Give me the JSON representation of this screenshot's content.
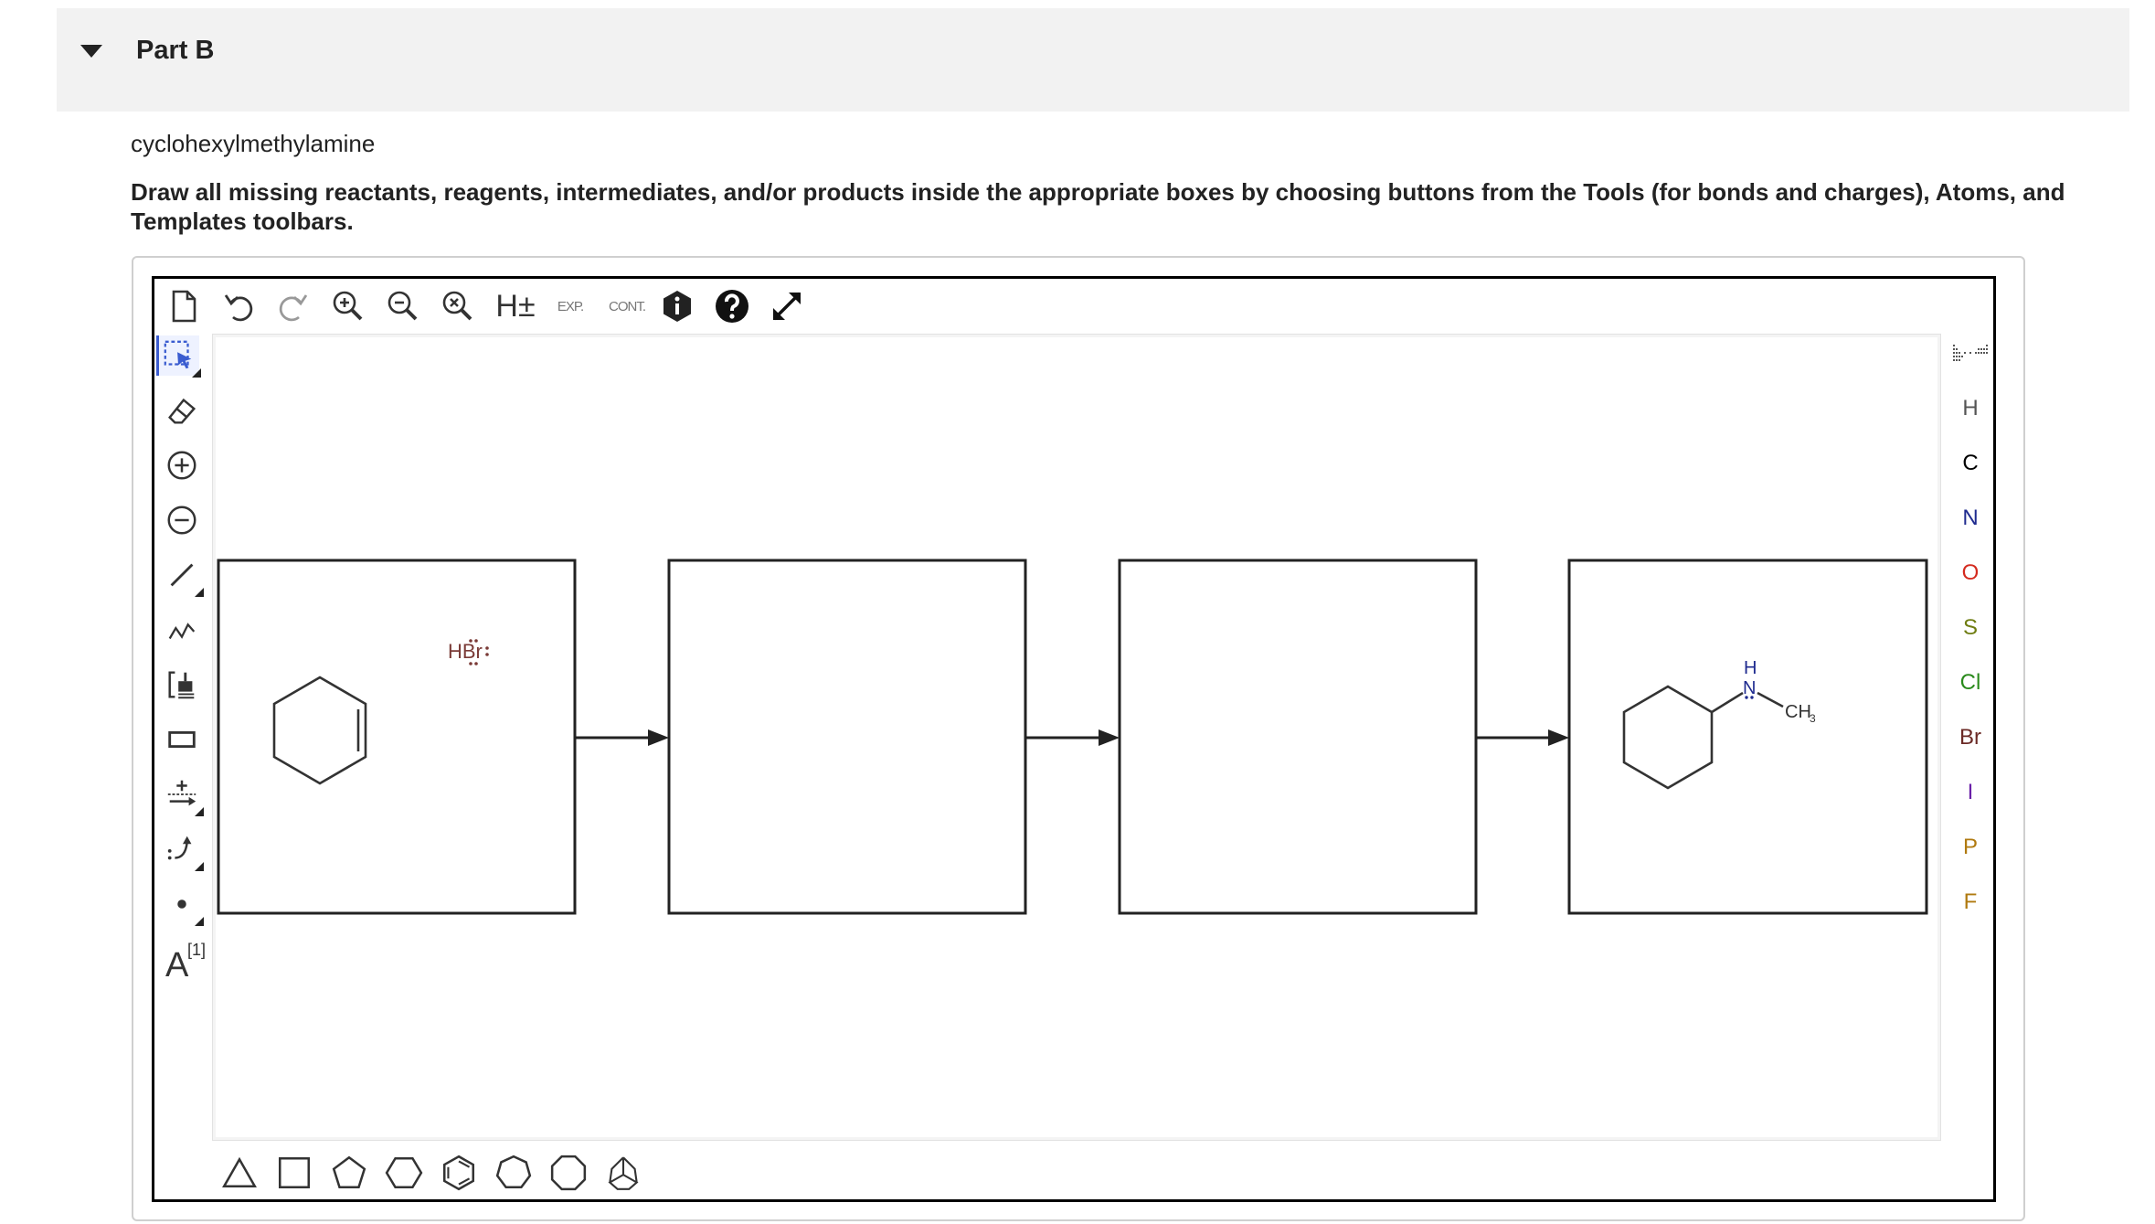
{
  "part": {
    "title": "Part B",
    "subtitle": "cyclohexylmethylamine",
    "instructions": "Draw all missing reactants, reagents, intermediates, and/or products inside the appropriate boxes by choosing buttons from the Tools (for bonds and charges), Atoms, and Templates toolbars."
  },
  "top_toolbar": {
    "implicit_h_label": "H±",
    "expand_label": "EXP.",
    "contract_label": "CONT."
  },
  "left_toolbar": {
    "text_tool_label": "A",
    "text_tool_superscript": "[1]"
  },
  "atoms": [
    {
      "symbol": "H",
      "color": "#555555"
    },
    {
      "symbol": "C",
      "color": "#000000"
    },
    {
      "symbol": "N",
      "color": "#1f2b8f"
    },
    {
      "symbol": "O",
      "color": "#d42a1e"
    },
    {
      "symbol": "S",
      "color": "#6f7d12"
    },
    {
      "symbol": "Cl",
      "color": "#2a8a1c"
    },
    {
      "symbol": "Br",
      "color": "#6b2a26"
    },
    {
      "symbol": "I",
      "color": "#6a1fa8"
    },
    {
      "symbol": "P",
      "color": "#b07a10"
    },
    {
      "symbol": "F",
      "color": "#b07a10"
    }
  ],
  "reaction": {
    "reagent_label": "HBr",
    "product_n_label": "N",
    "product_h_label": "H",
    "product_methyl_label": "CH",
    "product_methyl_subscript": "3"
  },
  "colors": {
    "reagent": "#7a3a36",
    "nitrogen": "#1f2b8f",
    "selection_accent": "#3a5cd0"
  }
}
